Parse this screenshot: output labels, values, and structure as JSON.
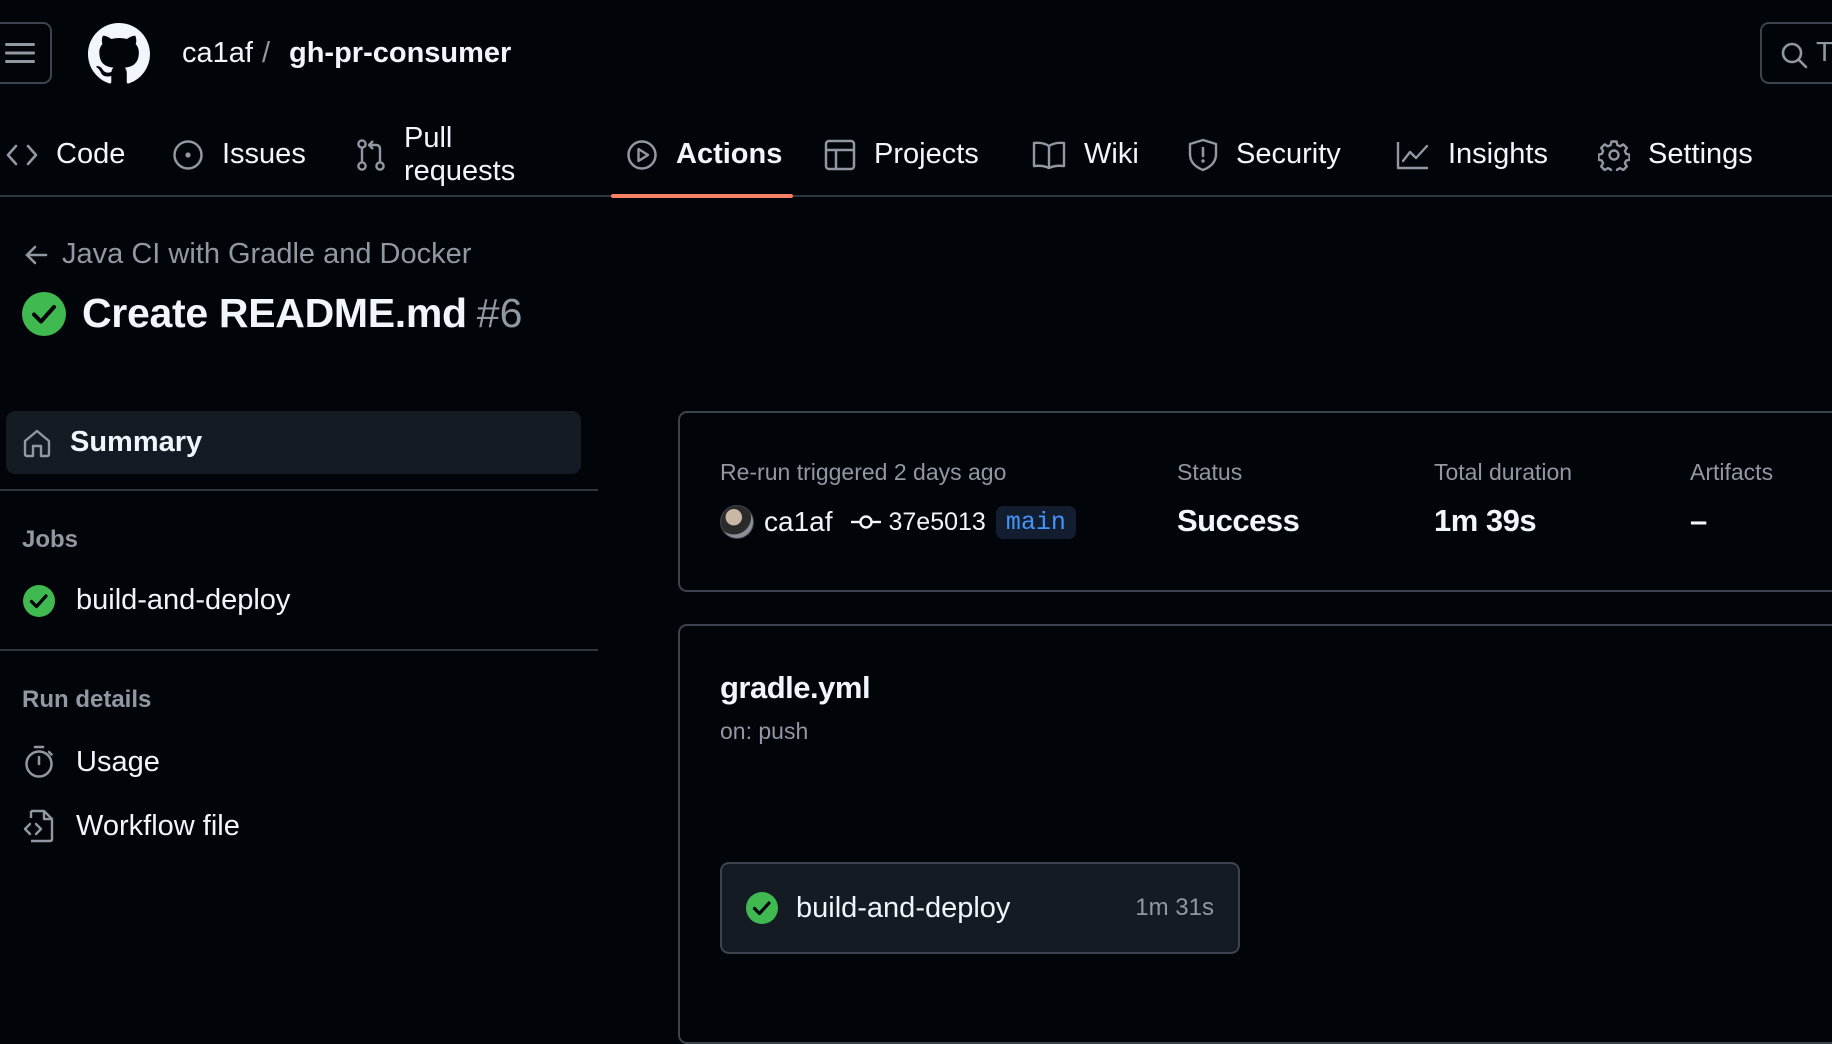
{
  "header": {
    "owner": "ca1af",
    "separator": "/",
    "repo": "gh-pr-consumer",
    "search_hint": "T"
  },
  "tabs": [
    {
      "label": "Code",
      "icon": "code-icon"
    },
    {
      "label": "Issues",
      "icon": "issue-opened-icon"
    },
    {
      "label": "Pull requests",
      "icon": "git-pull-request-icon"
    },
    {
      "label": "Actions",
      "icon": "play-icon",
      "active": true
    },
    {
      "label": "Projects",
      "icon": "table-icon"
    },
    {
      "label": "Wiki",
      "icon": "book-icon"
    },
    {
      "label": "Security",
      "icon": "shield-icon"
    },
    {
      "label": "Insights",
      "icon": "graph-icon"
    },
    {
      "label": "Settings",
      "icon": "gear-icon"
    }
  ],
  "run": {
    "workflow_name": "Java CI with Gradle and Docker",
    "title": "Create README.md",
    "number": "#6"
  },
  "sidebar": {
    "summary": "Summary",
    "jobs_heading": "Jobs",
    "jobs": [
      {
        "label": "build-and-deploy",
        "status": "success"
      }
    ],
    "details_heading": "Run details",
    "details": [
      {
        "label": "Usage",
        "icon": "stopwatch-icon"
      },
      {
        "label": "Workflow file",
        "icon": "file-code-icon"
      }
    ]
  },
  "summary": {
    "trigger_label": "Re-run triggered 2 days ago",
    "actor": "ca1af",
    "commit": "37e5013",
    "branch": "main",
    "status_label": "Status",
    "status_value": "Success",
    "duration_label": "Total duration",
    "duration_value": "1m 39s",
    "artifacts_label": "Artifacts",
    "artifacts_value": "–"
  },
  "workflow": {
    "file": "gradle.yml",
    "trigger": "on: push",
    "job": {
      "label": "build-and-deploy",
      "duration": "1m 31s",
      "status": "success"
    }
  },
  "colors": {
    "background": "#010409",
    "border": "#3d444d",
    "success": "#3fb950",
    "tab_underline": "#f78166",
    "branch_text": "#4493f8",
    "muted_text": "#9198a1"
  }
}
